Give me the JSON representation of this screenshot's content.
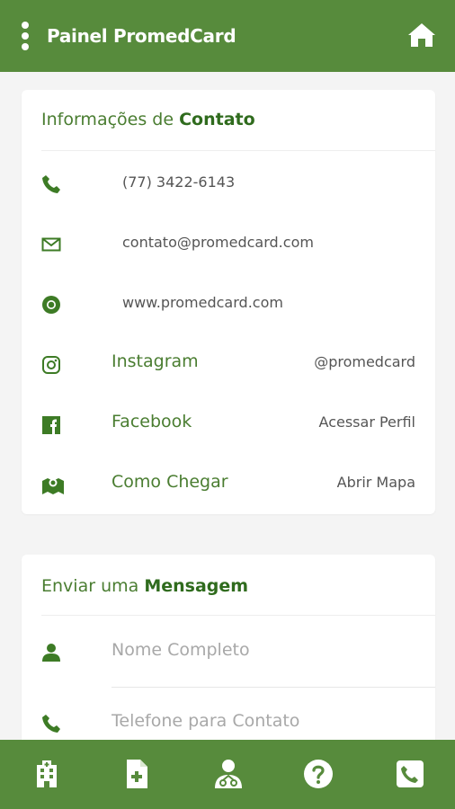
{
  "header": {
    "title": "Painel PromedCard",
    "menu_icon": "vertical-dots-icon",
    "home_icon": "home-icon"
  },
  "contact": {
    "title_prefix": "Informações de",
    "title_bold": "Contato",
    "phone": "(77) 3422-6143",
    "email": "contato@promedcard.com",
    "website": "www.promedcard.com",
    "instagram": {
      "label": "Instagram",
      "value": "@promedcard"
    },
    "facebook": {
      "label": "Facebook",
      "action": "Acessar Perfil"
    },
    "map": {
      "label": "Como Chegar",
      "action": "Abrir Mapa"
    }
  },
  "message": {
    "title_prefix": "Enviar uma",
    "title_bold": "Mensagem",
    "name_placeholder": "Nome Completo",
    "phone_placeholder": "Telefone para Contato"
  },
  "bottom_nav": [
    "building-icon",
    "file-medical-icon",
    "doctor-icon",
    "help-icon",
    "phone-square-icon"
  ],
  "colors": {
    "primary": "#578b3c",
    "accent_text": "#4a7d31",
    "background": "#f4f4f4"
  }
}
